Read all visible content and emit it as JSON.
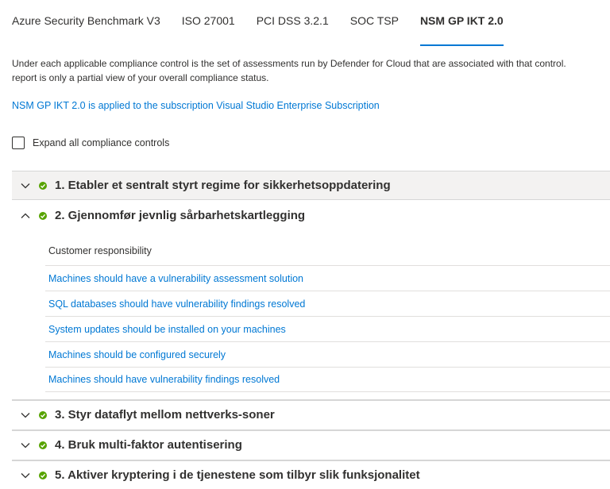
{
  "tabs": [
    {
      "label": "Azure Security Benchmark V3"
    },
    {
      "label": "ISO 27001"
    },
    {
      "label": "PCI DSS 3.2.1"
    },
    {
      "label": "SOC TSP"
    },
    {
      "label": "NSM GP IKT 2.0",
      "active": true
    }
  ],
  "description": {
    "line1": "Under each applicable compliance control is the set of assessments run by Defender for Cloud that are associated with that control.",
    "line2": "report is only a partial view of your overall compliance status."
  },
  "applied_link": "NSM GP IKT 2.0 is applied to the subscription Visual Studio Enterprise Subscription",
  "expand_all": {
    "label": "Expand all compliance controls",
    "checked": false
  },
  "controls": [
    {
      "title": "1. Etabler et sentralt styrt regime for sikkerhetsoppdatering",
      "expanded": false,
      "status": "passed"
    },
    {
      "title": "2. Gjennomfør jevnlig sårbarhetskartlegging",
      "expanded": true,
      "status": "passed"
    },
    {
      "title": "3. Styr dataflyt mellom nettverks-soner",
      "expanded": false,
      "status": "passed"
    },
    {
      "title": "4. Bruk multi-faktor autentisering",
      "expanded": false,
      "status": "passed"
    },
    {
      "title": "5. Aktiver kryptering i de tjenestene som tilbyr slik funksjonalitet",
      "expanded": false,
      "status": "passed"
    }
  ],
  "expanded_section": {
    "responsibility": "Customer responsibility",
    "assessments": [
      "Machines should have a vulnerability assessment solution",
      "SQL databases should have vulnerability findings resolved",
      "System updates should be installed on your machines",
      "Machines should be configured securely",
      "Machines should have vulnerability findings resolved"
    ]
  },
  "colors": {
    "accent": "#0078d4",
    "success": "#57a300"
  }
}
